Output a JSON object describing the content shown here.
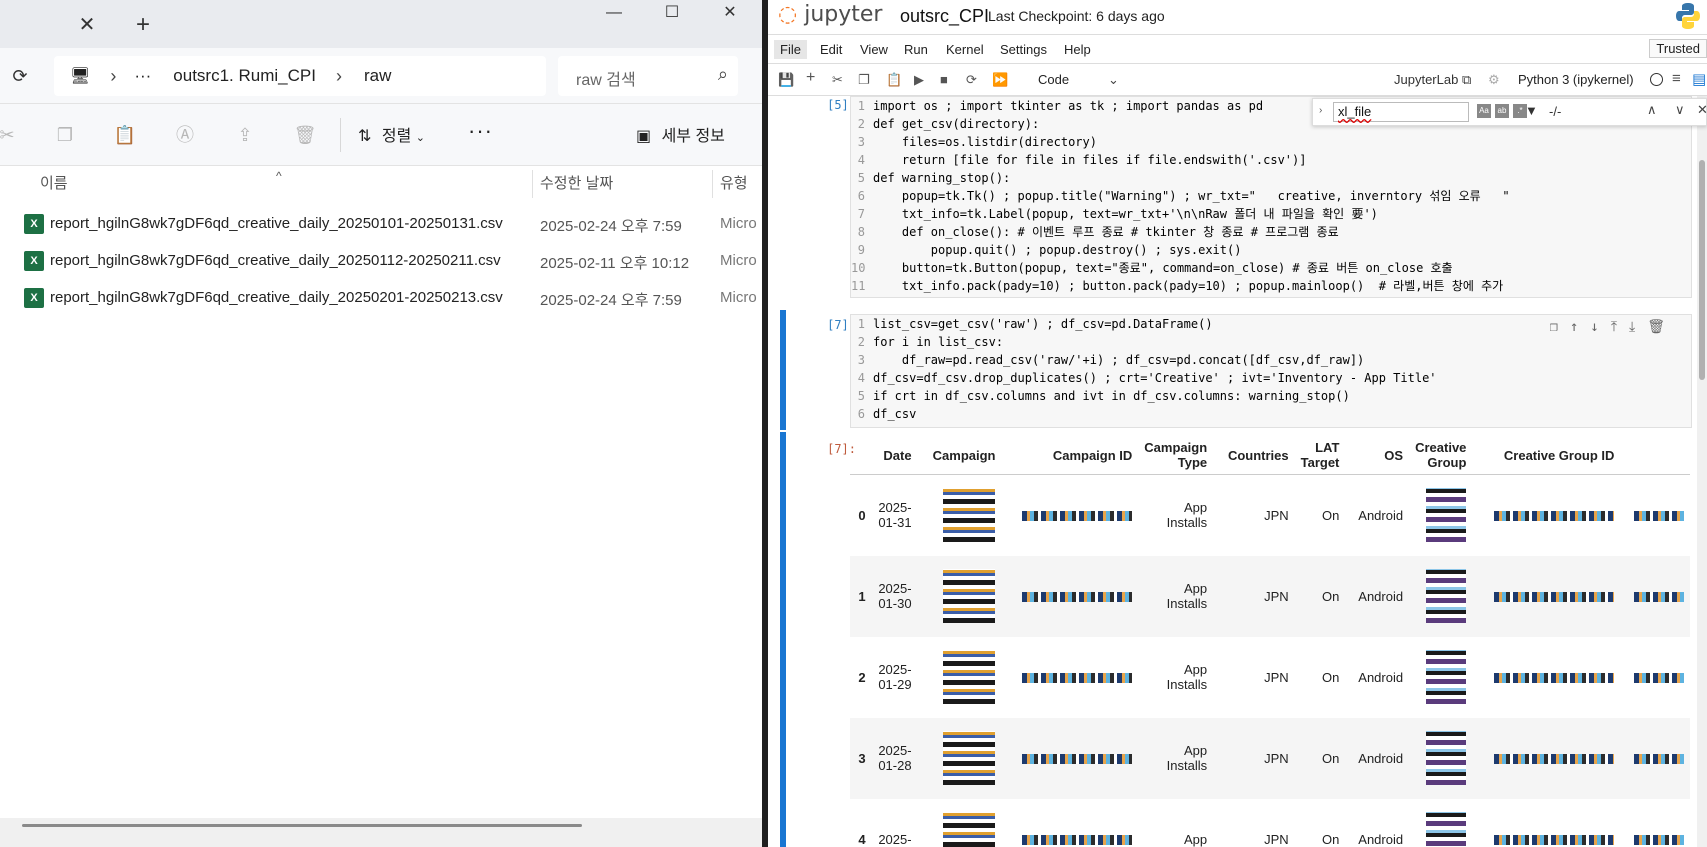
{
  "explorer": {
    "tab_close": "✕",
    "tab_new": "+",
    "window_buttons": {
      "minimize": "—",
      "maximize": "☐",
      "close": "✕"
    },
    "breadcrumb": {
      "more": "···",
      "folder": "outsrc1. Rumi_CPI",
      "current": "raw"
    },
    "search": {
      "placeholder": "raw 검색"
    },
    "toolbar": {
      "sort_label": "정렬",
      "more": "···",
      "details_label": "세부 정보"
    },
    "columns": {
      "name": "이름",
      "date": "수정한 날짜",
      "type": "유형"
    },
    "files": [
      {
        "name": "report_hgilnG8wk7gDF6qd_creative_daily_20250101-20250131.csv",
        "date": "2025-02-24 오후 7:59",
        "type": "Micro"
      },
      {
        "name": "report_hgilnG8wk7gDF6qd_creative_daily_20250112-20250211.csv",
        "date": "2025-02-11 오후 10:12",
        "type": "Micro"
      },
      {
        "name": "report_hgilnG8wk7gDF6qd_creative_daily_20250201-20250213.csv",
        "date": "2025-02-24 오후 7:59",
        "type": "Micro"
      }
    ]
  },
  "jupyter": {
    "logo": "jupyter",
    "notebook_name": "outsrc_CPI",
    "checkpoint": "Last Checkpoint: 6 days ago",
    "menu": [
      "File",
      "Edit",
      "View",
      "Run",
      "Kernel",
      "Settings",
      "Help"
    ],
    "trusted": "Trusted",
    "cell_type": "Code",
    "jupyterlab_link": "JupyterLab",
    "kernel": "Python 3 (ipykernel)",
    "find": {
      "query": "xl_file",
      "count": "-/-"
    },
    "cell1": {
      "prompt": "[5]:",
      "lines": [
        "import os ; import tkinter as tk ; import pandas as pd",
        "def get_csv(directory):",
        "    files=os.listdir(directory)",
        "    return [file for file in files if file.endswith('.csv')]",
        "def warning_stop():",
        "    popup=tk.Tk() ; popup.title(\"Warning\") ; wr_txt=\"   creative, inverntory 섞임 오류   \"",
        "    txt_info=tk.Label(popup, text=wr_txt+'\\n\\nRaw 폴더 내 파일을 확인 要')",
        "    def on_close(): # 이벤트 루프 종료 # tkinter 창 종료 # 프로그램 종료",
        "        popup.quit() ; popup.destroy() ; sys.exit()",
        "    button=tk.Button(popup, text=\"종료\", command=on_close) # 종료 버튼 on_close 호출",
        "    txt_info.pack(pady=10) ; button.pack(pady=10) ; popup.mainloop()  # 라벨,버튼 창에 추가"
      ]
    },
    "cell2": {
      "prompt": "[7]:",
      "lines": [
        "list_csv=get_csv('raw') ; df_csv=pd.DataFrame()",
        "for i in list_csv:",
        "    df_raw=pd.read_csv('raw/'+i) ; df_csv=pd.concat([df_csv,df_raw])",
        "df_csv=df_csv.drop_duplicates() ; crt='Creative' ; ivt='Inventory - App Title'",
        "if crt in df_csv.columns and ivt in df_csv.columns: warning_stop()",
        "df_csv"
      ]
    },
    "output": {
      "prompt": "[7]:",
      "headers": [
        "",
        "Date",
        "Campaign",
        "Campaign ID",
        "Campaign Type",
        "Countries",
        "LAT Target",
        "OS",
        "Creative Group",
        "Creative Group ID",
        ""
      ],
      "rows": [
        {
          "idx": "0",
          "date": "2025-01-31",
          "type": "App Installs",
          "country": "JPN",
          "lat": "On",
          "os": "Android"
        },
        {
          "idx": "1",
          "date": "2025-01-30",
          "type": "App Installs",
          "country": "JPN",
          "lat": "On",
          "os": "Android"
        },
        {
          "idx": "2",
          "date": "2025-01-29",
          "type": "App Installs",
          "country": "JPN",
          "lat": "On",
          "os": "Android"
        },
        {
          "idx": "3",
          "date": "2025-01-28",
          "type": "App Installs",
          "country": "JPN",
          "lat": "On",
          "os": "Android"
        },
        {
          "idx": "4",
          "date": "2025-",
          "type": "App",
          "country": "JPN",
          "lat": "On",
          "os": "Android"
        }
      ]
    }
  }
}
